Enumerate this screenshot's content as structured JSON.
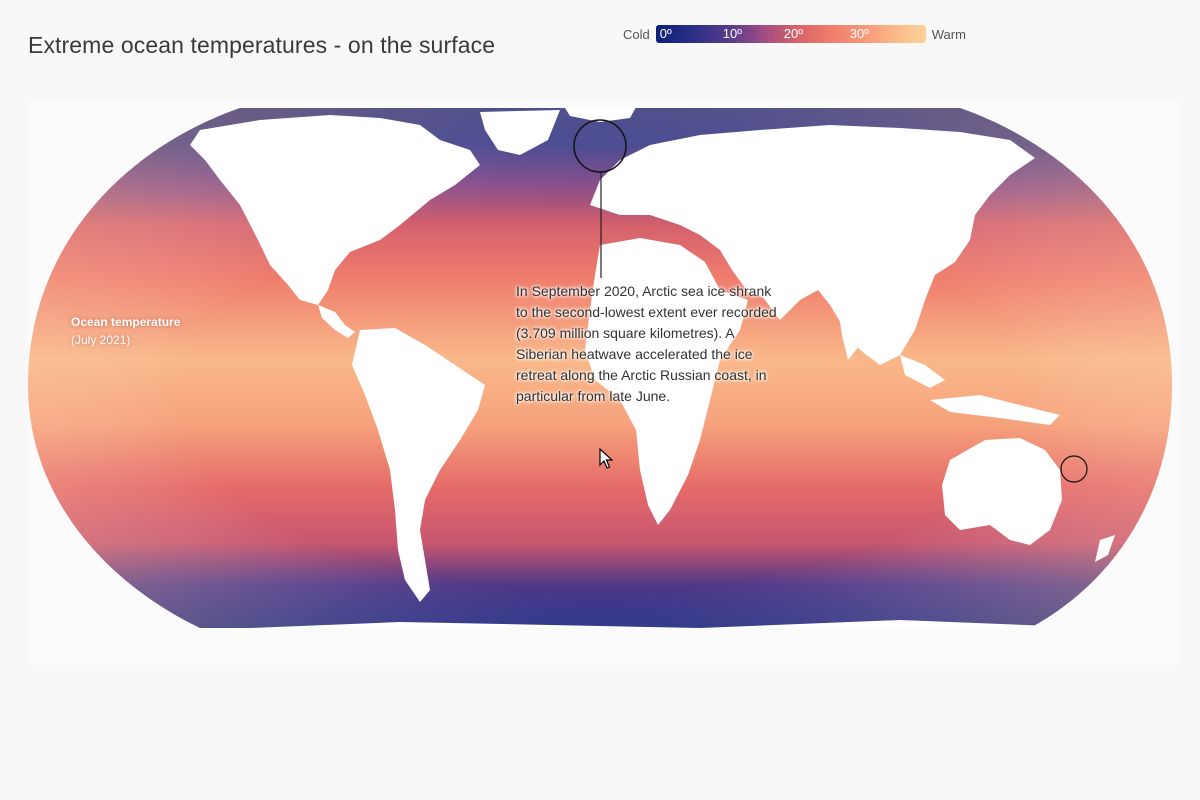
{
  "header": {
    "title": "Extreme ocean temperatures - on the surface"
  },
  "legend": {
    "cold_label": "Cold",
    "warm_label": "Warm",
    "ticks": [
      "0º",
      "10º",
      "20º",
      "30º"
    ],
    "color_stops": [
      "#0d1f7a",
      "#5a3c8c",
      "#d6626a",
      "#f79b7a",
      "#fcd29a"
    ]
  },
  "map": {
    "layer_label_bold": "Ocean temperature",
    "layer_label_rest": "(July 2021)",
    "colors": {
      "land": "#ffffff",
      "polar_water": "#1f2a8a",
      "temperate_water": "#e46a6c",
      "tropical_water": "#f8b284"
    }
  },
  "annotation": {
    "text": "In September 2020, Arctic sea ice shrank to the second-lowest extent ever recorded (3.709 million square kilometres). A Siberian heatwave accelerated the ice retreat along the Arctic Russian coast, in particular from late June."
  },
  "markers": [
    "arctic-russia-marker",
    "east-australia-marker"
  ]
}
